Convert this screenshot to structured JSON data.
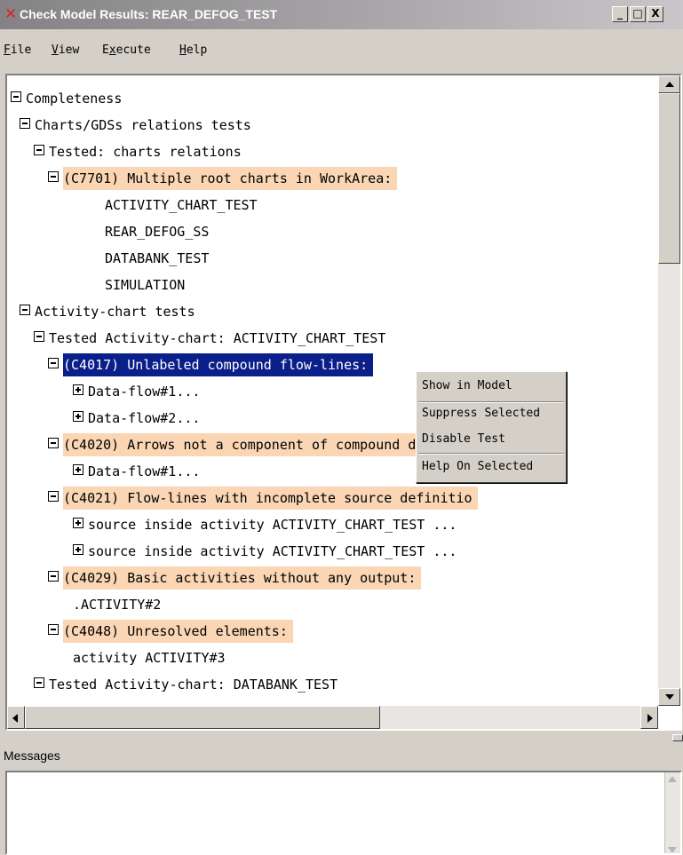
{
  "window": {
    "title": "Check Model Results: REAR_DEFOG_TEST",
    "minimize_glyph": "_",
    "maximize_glyph": "□",
    "close_glyph": "X"
  },
  "menu": {
    "file": {
      "mnemonic": "F",
      "rest": "ile"
    },
    "view": {
      "mnemonic": "V",
      "rest": "iew"
    },
    "execute": {
      "prefix": "E",
      "mnemonic": "x",
      "rest": "ecute"
    },
    "help": {
      "mnemonic": "H",
      "rest": "elp"
    }
  },
  "tree": {
    "rows": [
      {
        "text": "Completeness",
        "toggle": "minus",
        "style": "normal"
      },
      {
        "text": "Charts/GDSs relations tests",
        "toggle": "minus",
        "style": "normal"
      },
      {
        "text": "Tested: charts relations",
        "toggle": "minus",
        "style": "normal"
      },
      {
        "text": "(C7701)  Multiple root charts in WorkArea:",
        "toggle": "minus",
        "style": "highlight"
      },
      {
        "text": "ACTIVITY_CHART_TEST",
        "toggle": "none",
        "style": "normal"
      },
      {
        "text": "REAR_DEFOG_SS",
        "toggle": "none",
        "style": "normal"
      },
      {
        "text": "DATABANK_TEST",
        "toggle": "none",
        "style": "normal"
      },
      {
        "text": "SIMULATION",
        "toggle": "none",
        "style": "normal"
      },
      {
        "text": "Activity-chart tests",
        "toggle": "minus",
        "style": "normal"
      },
      {
        "text": "Tested Activity-chart:  ACTIVITY_CHART_TEST",
        "toggle": "minus",
        "style": "normal"
      },
      {
        "text": "(C4017)  Unlabeled compound flow-lines:",
        "toggle": "minus",
        "style": "selected"
      },
      {
        "text": "      Data-flow#1...",
        "toggle": "plus",
        "style": "normal"
      },
      {
        "text": "      Data-flow#2...",
        "toggle": "plus",
        "style": "normal"
      },
      {
        "text": "(C4020)  Arrows not a component of compound data",
        "toggle": "minus",
        "style": "highlight"
      },
      {
        "text": "      Data-flow#1...",
        "toggle": "plus",
        "style": "normal"
      },
      {
        "text": "(C4021)  Flow-lines with incomplete source definitio",
        "toggle": "minus",
        "style": "highlight"
      },
      {
        "text": "source inside activity ACTIVITY_CHART_TEST ...",
        "toggle": "plus",
        "style": "normal"
      },
      {
        "text": "source inside activity ACTIVITY_CHART_TEST ...",
        "toggle": "plus",
        "style": "normal"
      },
      {
        "text": "(C4029)  Basic activities without any output:",
        "toggle": "minus",
        "style": "highlight"
      },
      {
        "text": ".ACTIVITY#2",
        "toggle": "none",
        "style": "normal"
      },
      {
        "text": "(C4048)  Unresolved elements:",
        "toggle": "minus",
        "style": "highlight"
      },
      {
        "text": "activity ACTIVITY#3",
        "toggle": "none",
        "style": "normal"
      },
      {
        "text": "Tested Activity-chart:  DATABANK_TEST",
        "toggle": "minus",
        "style": "normal"
      }
    ]
  },
  "context_menu": {
    "items": [
      "Show in Model",
      "Suppress Selected",
      "Disable Test",
      "Help On Selected"
    ]
  },
  "messages": {
    "label": "Messages"
  },
  "colors": {
    "highlight": "#fad6b4",
    "selected": "#0a1f8a",
    "titlebar": "#848284"
  }
}
